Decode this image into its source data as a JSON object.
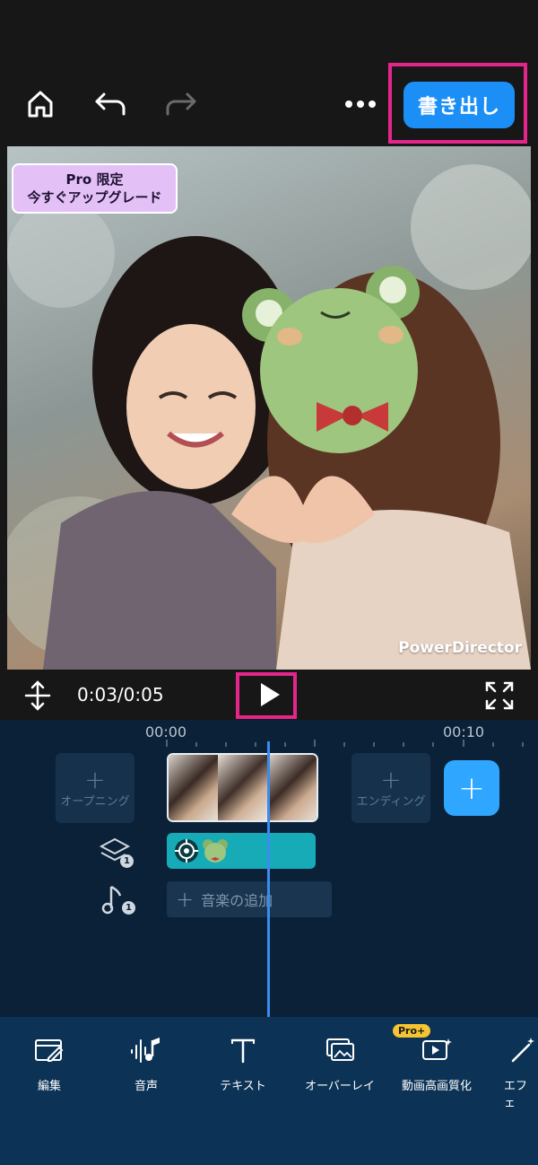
{
  "toolbar_top": {
    "home": "home-icon",
    "undo": "undo-icon",
    "redo": "redo-icon",
    "more": "more-icon",
    "export_label": "書き出し"
  },
  "preview": {
    "pro_line1": "Pro 限定",
    "pro_line2": "今すぐアップグレード",
    "watermark": "PowerDirector"
  },
  "controls": {
    "time": "0:03/0:05"
  },
  "timeline": {
    "tick_start": "00:00",
    "tick_end": "00:10",
    "opening_label": "オープニング",
    "ending_label": "エンディング",
    "overlay_count": "1",
    "music_count": "1",
    "add_music_label": "音楽の追加"
  },
  "tools": [
    {
      "label": "編集",
      "icon": "edit-icon"
    },
    {
      "label": "音声",
      "icon": "audio-icon"
    },
    {
      "label": "テキスト",
      "icon": "text-icon"
    },
    {
      "label": "オーバーレイ",
      "icon": "overlay-icon"
    },
    {
      "label": "動画高画質化",
      "icon": "enhance-icon",
      "badge": "Pro+"
    },
    {
      "label": "エフェ",
      "icon": "effect-icon"
    }
  ],
  "colors": {
    "accent": "#1c8ff6",
    "highlight": "#e4268c",
    "overlay_clip": "#17aab7",
    "playhead": "#3b8cf0"
  }
}
